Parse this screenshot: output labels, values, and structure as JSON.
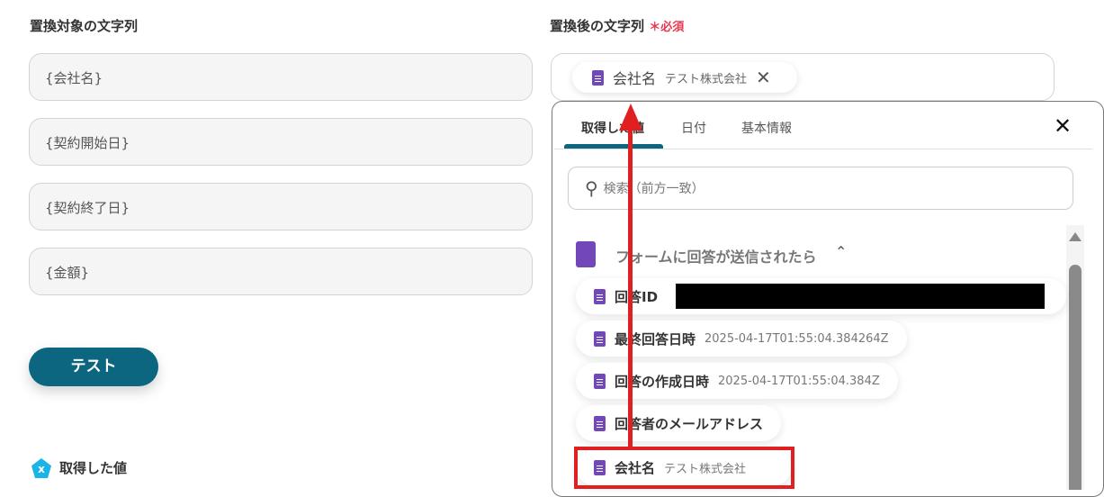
{
  "left": {
    "label": "置換対象の文字列",
    "fields": [
      "{会社名}",
      "{契約開始日}",
      "{契約終了日}",
      "{金額}"
    ],
    "test_button": "テスト",
    "retrieved_label": "取得した値"
  },
  "right": {
    "label": "置換後の文字列",
    "required_mark": "＊",
    "required": "必須",
    "chip": {
      "key": "会社名",
      "value": "テスト株式会社"
    }
  },
  "panel": {
    "tabs": [
      "取得した値",
      "日付",
      "基本情報"
    ],
    "active_tab": 0,
    "search_placeholder": "検索（前方一致）",
    "group": "フォームに回答が送信されたら",
    "items": [
      {
        "key": "回答ID",
        "value": ""
      },
      {
        "key": "最終回答日時",
        "value": "2025-04-17T01:55:04.384264Z"
      },
      {
        "key": "回答の作成日時",
        "value": "2025-04-17T01:55:04.384Z"
      },
      {
        "key": "回答者のメールアドレス",
        "value": ""
      },
      {
        "key": "会社名",
        "value": "テスト株式会社"
      }
    ]
  },
  "colors": {
    "accent": "#0d6680",
    "highlight": "#e02020",
    "icon": "#7248b9"
  }
}
